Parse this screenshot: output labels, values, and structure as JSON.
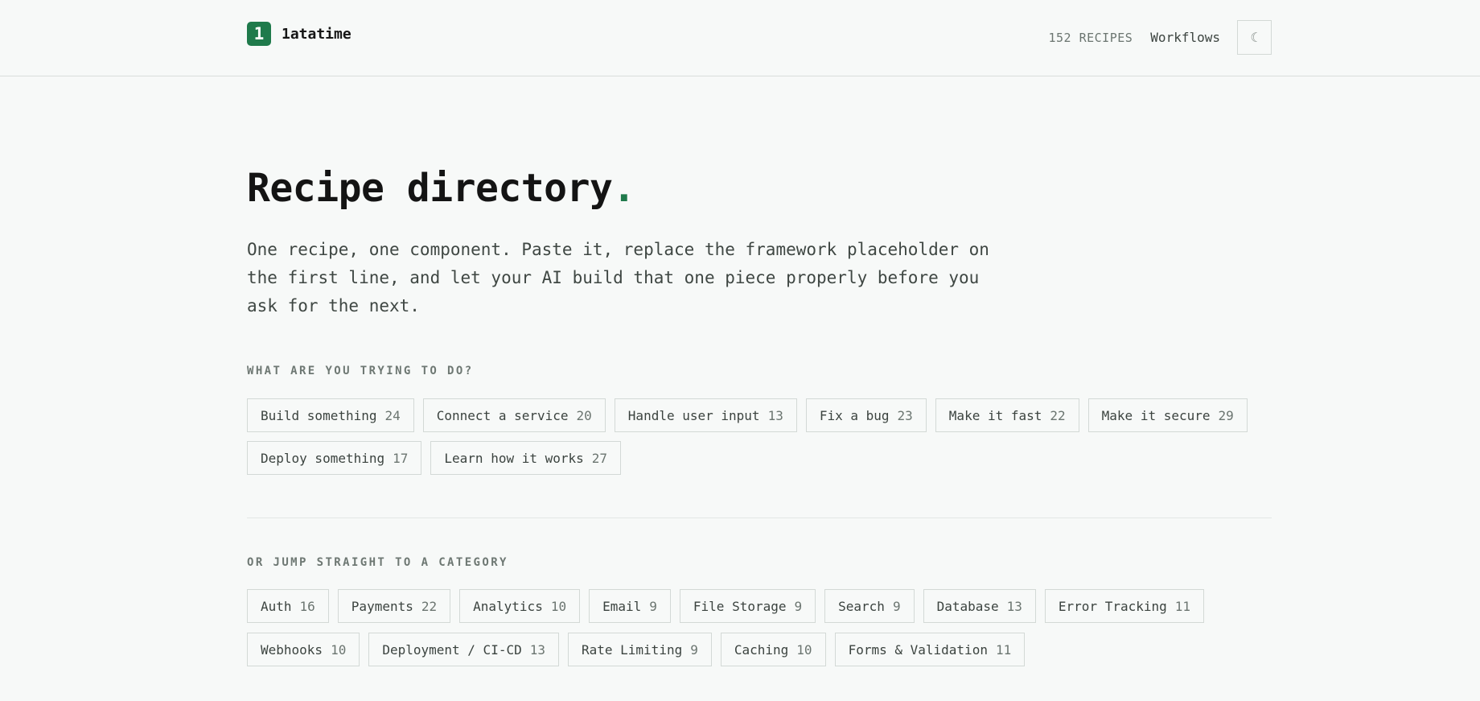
{
  "header": {
    "logo_glyph": "1",
    "brand_name": "1atatime",
    "recipe_count_label": "152 RECIPES",
    "workflows_link": "Workflows",
    "theme_toggle_glyph": "☾"
  },
  "hero": {
    "title": "Recipe directory",
    "title_accent": ".",
    "description": "One recipe, one component. Paste it, replace the framework placeholder on the first line, and let your AI build that one piece properly before you ask for the next."
  },
  "intents": {
    "label": "WHAT ARE YOU TRYING TO DO?",
    "items": [
      {
        "label": "Build something",
        "count": "24"
      },
      {
        "label": "Connect a service",
        "count": "20"
      },
      {
        "label": "Handle user input",
        "count": "13"
      },
      {
        "label": "Fix a bug",
        "count": "23"
      },
      {
        "label": "Make it fast",
        "count": "22"
      },
      {
        "label": "Make it secure",
        "count": "29"
      },
      {
        "label": "Deploy something",
        "count": "17"
      },
      {
        "label": "Learn how it works",
        "count": "27"
      }
    ]
  },
  "categories": {
    "label": "OR JUMP STRAIGHT TO A CATEGORY",
    "items": [
      {
        "label": "Auth",
        "count": "16"
      },
      {
        "label": "Payments",
        "count": "22"
      },
      {
        "label": "Analytics",
        "count": "10"
      },
      {
        "label": "Email",
        "count": "9"
      },
      {
        "label": "File Storage",
        "count": "9"
      },
      {
        "label": "Search",
        "count": "9"
      },
      {
        "label": "Database",
        "count": "13"
      },
      {
        "label": "Error Tracking",
        "count": "11"
      },
      {
        "label": "Webhooks",
        "count": "10"
      },
      {
        "label": "Deployment / CI-CD",
        "count": "13"
      },
      {
        "label": "Rate Limiting",
        "count": "9"
      },
      {
        "label": "Caching",
        "count": "10"
      },
      {
        "label": "Forms & Validation",
        "count": "11"
      }
    ]
  },
  "colors": {
    "accent": "#1f7a4b",
    "background": "#f7f9f8",
    "border": "#d3d9d6"
  }
}
